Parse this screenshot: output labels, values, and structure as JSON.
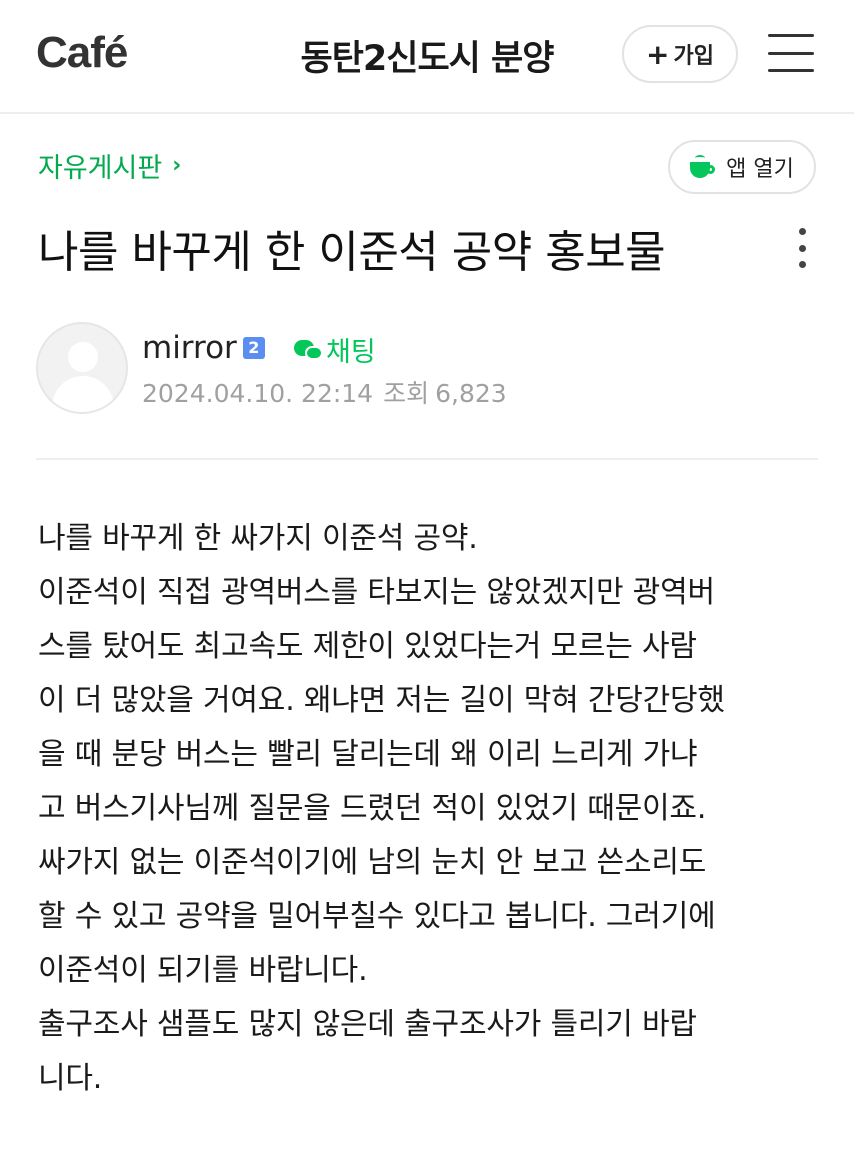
{
  "header": {
    "logo": "Café",
    "cafe_name": "동탄2신도시 분양",
    "join_label": "가입",
    "menu_icon": "hamburger-icon"
  },
  "board": {
    "name": "자유게시판",
    "app_open_label": "앱 열기",
    "accent": "#03c75a"
  },
  "post": {
    "title": "나를 바꾸게 한 이준석 공약 홍보물",
    "author": "mirror",
    "level": "2",
    "chat_label": "채팅",
    "date": "2024.04.10. 22:14",
    "views_label": "조회",
    "views": "6,823",
    "lines": [
      "나를 바꾸게 한 싸가지 이준석 공약.",
      "이준석이 직접 광역버스를 타보지는 않았겠지만 광역버",
      "스를 탔어도 최고속도 제한이 있었다는거 모르는 사람",
      "이 더 많았을 거여요. 왜냐면 저는 길이 막혀 간당간당했",
      "을 때 분당 버스는 빨리 달리는데 왜 이리 느리게 가냐",
      "고 버스기사님께 질문을 드렸던 적이 있었기 때문이죠.",
      "싸가지 없는 이준석이기에 남의 눈치 안 보고 쓴소리도",
      "할 수 있고 공약을 밀어부칠수 있다고 봅니다. 그러기에",
      "이준석이 되기를 바랍니다.",
      "출구조사 샘플도 많지 않은데 출구조사가 틀리기 바랍",
      "니다."
    ]
  }
}
